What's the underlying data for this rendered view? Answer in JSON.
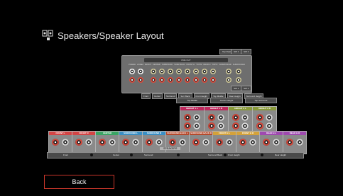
{
  "header": {
    "title": "Speakers/Speaker Layout",
    "icon": "speaker-settings-icon"
  },
  "pre_out": {
    "head": "PRE OUT",
    "channel_labels": [
      "POWER",
      "ZONE2",
      "FRONT",
      "CENTER",
      "SURROUND",
      "SURR BACK",
      "FRONT H",
      "TOP M",
      "REAR H",
      "TOP R",
      "SUBWOOFER",
      "SUBWOOFER"
    ],
    "bottom_labels": [
      "Front",
      "Center",
      "Surround",
      "Surr Back",
      "Front Height",
      "Top Middle",
      "Rear Height",
      "Surround Height"
    ],
    "right_labels": [
      "Top Rear",
      "SW 1",
      "SW 2"
    ],
    "right_bottom_labels": [
      "SW 1",
      "SW 2"
    ]
  },
  "upper": {
    "labels": [
      "Top Middle",
      "Center Height",
      "Top Surround"
    ],
    "blocks": [
      {
        "label": "HEIGHT 1 L",
        "color": "#c0285d"
      },
      {
        "label": "HEIGHT 1 R",
        "color": "#c0285d"
      },
      {
        "label": "HEIGHT 2 L",
        "color": "#8a9a3a"
      },
      {
        "label": "HEIGHT 2 R",
        "color": "#8a9a3a"
      }
    ]
  },
  "speakers": {
    "label": "SPEAKERS",
    "blocks": [
      {
        "label": "FRONT L",
        "color": "#d34545"
      },
      {
        "label": "FRONT R",
        "color": "#d34545"
      },
      {
        "label": "CENTER",
        "color": "#3aa564"
      },
      {
        "label": "SURROUND L",
        "color": "#3a8fc4"
      },
      {
        "label": "SURROUND R",
        "color": "#3a8fc4"
      },
      {
        "label": "SURROUND BACK L",
        "color": "#b54a2c"
      },
      {
        "label": "SURROUND BACK R",
        "color": "#b54a2c"
      },
      {
        "label": "FRONT H L",
        "color": "#d4a23a"
      },
      {
        "label": "FRONT H R",
        "color": "#d4a23a"
      },
      {
        "label": "REAR H L",
        "color": "#9f4ab0"
      },
      {
        "label": "REAR H R",
        "color": "#9f4ab0"
      }
    ],
    "bar_labels": [
      "Front",
      "Center",
      "Surround",
      "Surround Back",
      "Front Height",
      "Rear Height"
    ]
  },
  "footer": {
    "back_label": "Back"
  }
}
